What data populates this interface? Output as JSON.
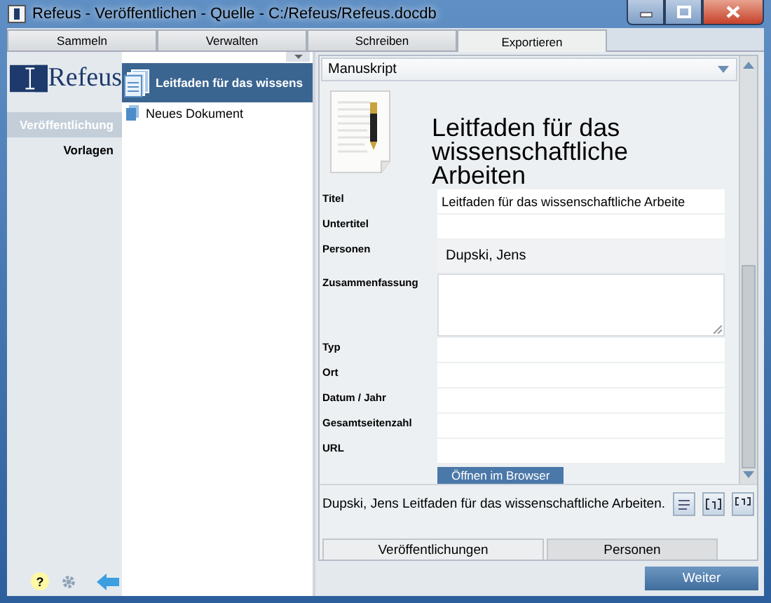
{
  "window": {
    "title": "Refeus - Veröffentlichen - Quelle - C:/Refeus/Refeus.docdb"
  },
  "tabs": [
    {
      "label": "Sammeln",
      "selected": false
    },
    {
      "label": "Verwalten",
      "selected": false
    },
    {
      "label": "Schreiben",
      "selected": false
    },
    {
      "label": "Exportieren",
      "selected": true
    }
  ],
  "sidebar": {
    "logo": "Refeus",
    "items": [
      {
        "label": "Veröffentlichung",
        "selected": true
      },
      {
        "label": "Vorlagen",
        "selected": false
      }
    ],
    "help": "?"
  },
  "documents": [
    {
      "title": "Leitfaden für das wissens",
      "selected": true
    },
    {
      "title": "Neues Dokument",
      "selected": false
    }
  ],
  "detail": {
    "template": "Manuskript",
    "heading": "Leitfaden für das wissenschaftliche Arbeiten",
    "fields": [
      {
        "label": "Titel",
        "kind": "line",
        "value": "Leitfaden für das wissenschaftliche Arbeite"
      },
      {
        "label": "Untertitel",
        "kind": "line"
      },
      {
        "label": "Personen",
        "kind": "persons",
        "value": "Dupski, Jens"
      },
      {
        "label": "Zusammenfassung",
        "kind": "area"
      },
      {
        "label": "Typ",
        "kind": "line"
      },
      {
        "label": "Ort",
        "kind": "line"
      },
      {
        "label": "Datum / Jahr",
        "kind": "line"
      },
      {
        "label": "Gesamtseitenzahl",
        "kind": "line"
      },
      {
        "label": "URL",
        "kind": "line"
      }
    ],
    "open_button": "Öffnen im Browser",
    "citation": "Dupski, Jens Leitfaden für das wissenschaftliche Arbeiten."
  },
  "bottom_tabs": [
    {
      "label": "Veröffentlichungen",
      "selected": true
    },
    {
      "label": "Personen",
      "selected": false
    }
  ],
  "next_button": "Weiter"
}
